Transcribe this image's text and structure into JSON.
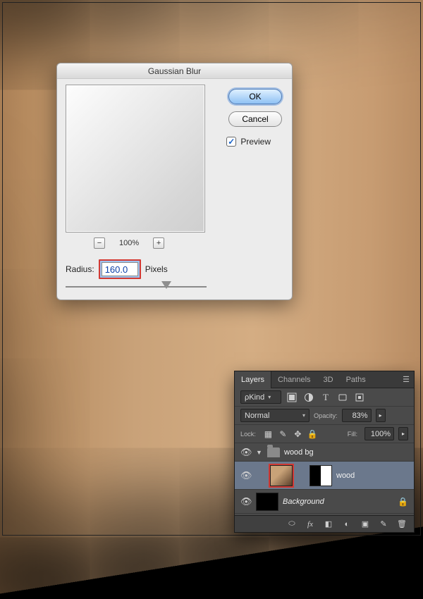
{
  "dialog": {
    "title": "Gaussian Blur",
    "ok_label": "OK",
    "cancel_label": "Cancel",
    "preview_label": "Preview",
    "preview_checked": true,
    "zoom_level": "100%",
    "radius_label": "Radius:",
    "radius_value": "160.0",
    "radius_unit": "Pixels",
    "highlight_color": "#d23a34"
  },
  "layers_panel": {
    "tabs": [
      "Layers",
      "Channels",
      "3D",
      "Paths"
    ],
    "active_tab": 0,
    "filter_kind": "Kind",
    "blend_mode": "Normal",
    "opacity_label": "Opacity:",
    "opacity_value": "83%",
    "lock_label": "Lock:",
    "fill_label": "Fill:",
    "fill_value": "100%",
    "group": {
      "name": "wood bg"
    },
    "layer": {
      "name": "wood",
      "selected": true
    },
    "background": {
      "name": "Background",
      "locked": true
    }
  },
  "colors": {
    "mac_button_blue": "#8fc1f4",
    "panel_bg": "#4a4a4a"
  }
}
